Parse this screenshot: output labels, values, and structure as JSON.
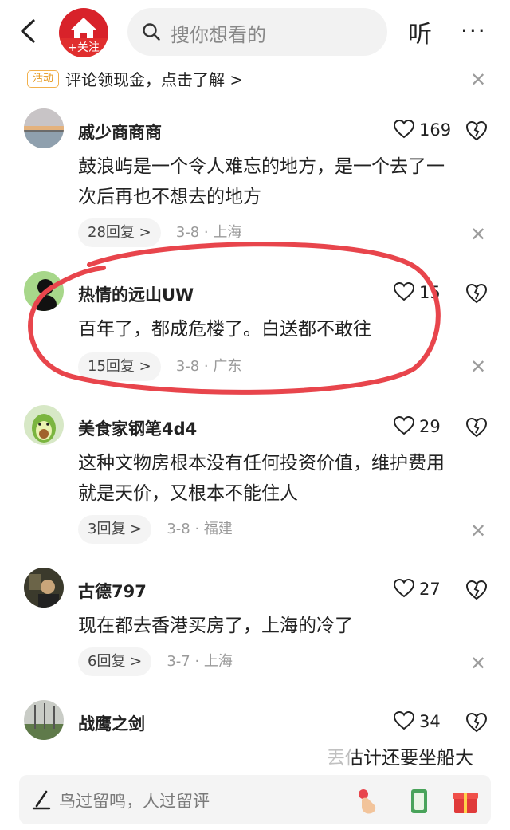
{
  "top": {
    "follow_label": "+关注",
    "search_placeholder": "搜你想看的",
    "listen_label": "听",
    "more_label": "···"
  },
  "activity": {
    "tag": "活动",
    "text": "评论领现金，点击了解 >"
  },
  "comments": [
    {
      "name": "戚少商商商",
      "likes": "169",
      "text_lines": [
        "鼓浪屿是一个令人难忘的地方，是一个去了一",
        "次后再也不想去的地方"
      ],
      "replies": "28回复 >",
      "date": "3-8 · 上海"
    },
    {
      "name": "热情的远山UW",
      "likes": "15",
      "text_lines": [
        "百年了，都成危楼了。白送都不敢往"
      ],
      "replies": "15回复 >",
      "date": "3-8 · 广东"
    },
    {
      "name": "美食家钢笔4d4",
      "likes": "29",
      "text_lines": [
        "这种文物房根本没有任何投资价值，维护费用",
        "就是天价，又根本不能住人"
      ],
      "replies": "3回复 >",
      "date": "3-8 · 福建"
    },
    {
      "name": "古德797",
      "likes": "27",
      "text_lines": [
        "现在都去香港买房了，上海的冷了"
      ],
      "replies": "6回复 >",
      "date": "3-7 · 上海"
    },
    {
      "name": "战鹰之剑",
      "likes": "34",
      "text_lines": [
        "丟估计还要坐船大"
      ]
    }
  ],
  "bottom": {
    "placeholder": "鸟过留鸣，人过留评"
  },
  "colors": {
    "accent_red": "#e02e2e",
    "annotation_red": "#e8454c",
    "activity_orange": "#e69a22"
  }
}
